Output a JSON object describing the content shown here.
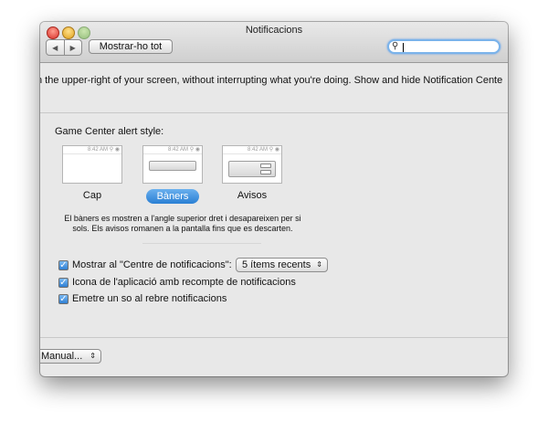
{
  "window": {
    "title": "Notificacions"
  },
  "toolbar": {
    "back_icon": "◀",
    "forward_icon": "▶",
    "show_all_label": "Mostrar-ho tot",
    "search_icon": "magnifier-icon",
    "search_value": ""
  },
  "intro_text": "n the upper-right of your screen, without interrupting what you're doing. Show and hide Notification Cente",
  "game_center": {
    "label": "Game Center alert style:",
    "styles": [
      {
        "label": "Cap",
        "time": "8:42 AM",
        "selected": false
      },
      {
        "label": "Bàners",
        "time": "8:42 AM",
        "selected": true
      },
      {
        "label": "Avisos",
        "time": "8:42 AM",
        "selected": false
      }
    ],
    "description": "El bàners es mostren a l'angle superior dret i desapareixen per si sols. Els avisos romanen a la pantalla fins que es descarten."
  },
  "options": {
    "show_in_center_label": "Mostrar al \"Centre de notificacions\":",
    "recent_items_value": "5 ítems recents",
    "badge_icon_label": "Icona de l'aplicació amb recompte de notificacions",
    "play_sound_label": "Emetre un so al rebre notificacions"
  },
  "sort_order": {
    "value": "Manual..."
  },
  "colors": {
    "accent": "#2a7fd4",
    "window_bg": "#e8e8e8",
    "focus_ring": "#7ab3ea"
  }
}
